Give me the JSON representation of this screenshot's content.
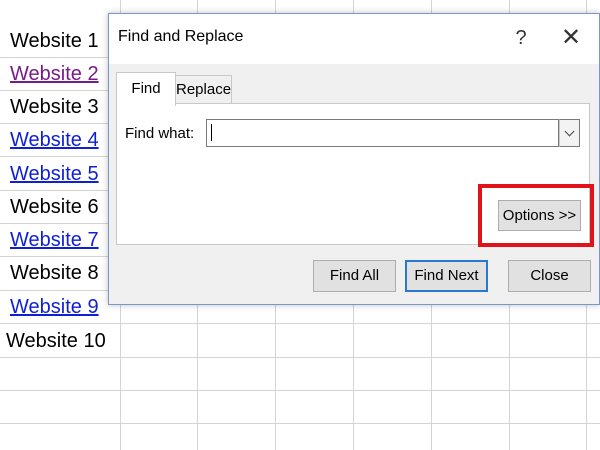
{
  "sheet": {
    "rows": [
      {
        "text": "Website 1",
        "style": "plain"
      },
      {
        "text": "Website 2",
        "style": "visited-link"
      },
      {
        "text": "Website 3",
        "style": "plain"
      },
      {
        "text": "Website 4",
        "style": "link"
      },
      {
        "text": "Website 5",
        "style": "link"
      },
      {
        "text": "Website 6",
        "style": "plain"
      },
      {
        "text": "Website 7",
        "style": "link"
      },
      {
        "text": "Website 8",
        "style": "plain"
      },
      {
        "text": "Website 9",
        "style": "link"
      },
      {
        "text": "Website 10",
        "style": "plain"
      }
    ],
    "colors": {
      "link": "#0f1fd6",
      "visited": "#7a1a8a",
      "grid": "#d4d4d4"
    }
  },
  "dialog": {
    "title": "Find and Replace",
    "help_icon": "?",
    "close_icon": "✕",
    "tabs": [
      {
        "label": "Find",
        "active": true
      },
      {
        "label": "Replace",
        "active": false
      }
    ],
    "find_label": "Find what:",
    "find_value": "",
    "dropdown_icon": "chevron-down-icon",
    "options_button": "Options >>",
    "buttons": {
      "find_all": "Find All",
      "find_next": "Find Next",
      "close": "Close"
    },
    "highlight_color": "#e0121a"
  }
}
